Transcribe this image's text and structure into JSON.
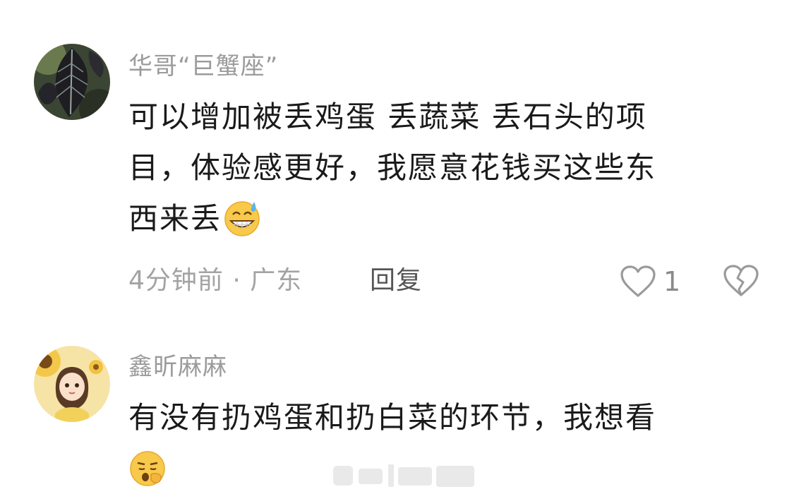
{
  "comments": [
    {
      "username": "华哥“巨蟹座”",
      "avatar_icon": "dark-plant-leaf-avatar",
      "content_lines": [
        "可以增加被丢鸡蛋  丢蔬菜  丢石头的项",
        "目，体验感更好，我愿意花钱买这些东",
        "西来丢"
      ],
      "content_emoji": "grinning-sweat-emoji",
      "time": "4分钟前",
      "separator": " · ",
      "location": "广东",
      "reply_label": "回复",
      "likes": "1",
      "like_icon": "heart-outline-icon",
      "dislike_icon": "broken-heart-icon"
    },
    {
      "username": "鑫昕麻麻",
      "avatar_icon": "girl-with-sunflower-avatar",
      "content_lines": [
        "有没有扔鸡蛋和扔白菜的环节，我想看"
      ],
      "content_emoji": "yawning-emoji"
    }
  ],
  "watermark_icon": "weibo-watermark"
}
